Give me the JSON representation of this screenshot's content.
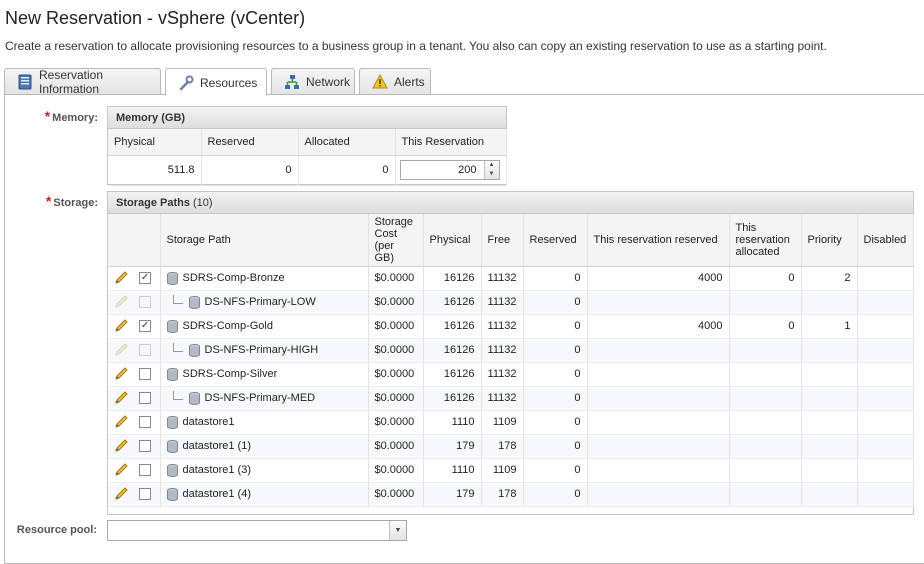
{
  "page": {
    "title": "New Reservation - vSphere (vCenter)",
    "description": "Create a reservation to allocate provisioning resources to a business group in a tenant. You also can copy an existing reservation to use as a starting point."
  },
  "tabs": [
    {
      "label": "Reservation Information",
      "icon": "reservation-info-icon",
      "active": false
    },
    {
      "label": "Resources",
      "icon": "wrench-icon",
      "active": true
    },
    {
      "label": "Network",
      "icon": "network-icon",
      "active": false
    },
    {
      "label": "Alerts",
      "icon": "warning-icon",
      "active": false
    }
  ],
  "memory": {
    "label": "Memory:",
    "panel_title": "Memory (GB)",
    "columns": [
      "Physical",
      "Reserved",
      "Allocated",
      "This Reservation"
    ],
    "values": {
      "physical": "511.8",
      "reserved": "0",
      "allocated": "0",
      "this_reservation": "200"
    }
  },
  "storage": {
    "label": "Storage:",
    "panel_title": "Storage Paths",
    "count": "(10)",
    "columns": [
      "Storage Path",
      "Storage Cost (per GB)",
      "Physical",
      "Free",
      "Reserved",
      "This reservation reserved",
      "This reservation allocated",
      "Priority",
      "Disabled"
    ],
    "rows": [
      {
        "path": "SDRS-Comp-Bronze",
        "child": false,
        "enabled": true,
        "checked": true,
        "cost": "$0.0000",
        "physical": "16126",
        "free": "11132",
        "reserved": "0",
        "this_reserved": "4000",
        "this_allocated": "0",
        "priority": "2",
        "disabled": ""
      },
      {
        "path": "DS-NFS-Primary-LOW",
        "child": true,
        "enabled": false,
        "checked": false,
        "cost": "$0.0000",
        "physical": "16126",
        "free": "11132",
        "reserved": "0",
        "this_reserved": "",
        "this_allocated": "",
        "priority": "",
        "disabled": ""
      },
      {
        "path": "SDRS-Comp-Gold",
        "child": false,
        "enabled": true,
        "checked": true,
        "cost": "$0.0000",
        "physical": "16126",
        "free": "11132",
        "reserved": "0",
        "this_reserved": "4000",
        "this_allocated": "0",
        "priority": "1",
        "disabled": ""
      },
      {
        "path": "DS-NFS-Primary-HIGH",
        "child": true,
        "enabled": false,
        "checked": false,
        "cost": "$0.0000",
        "physical": "16126",
        "free": "11132",
        "reserved": "0",
        "this_reserved": "",
        "this_allocated": "",
        "priority": "",
        "disabled": ""
      },
      {
        "path": "SDRS-Comp-Silver",
        "child": false,
        "enabled": true,
        "checked": false,
        "cost": "$0.0000",
        "physical": "16126",
        "free": "11132",
        "reserved": "0",
        "this_reserved": "",
        "this_allocated": "",
        "priority": "",
        "disabled": ""
      },
      {
        "path": "DS-NFS-Primary-MED",
        "child": true,
        "enabled": true,
        "checked": false,
        "cost": "$0.0000",
        "physical": "16126",
        "free": "11132",
        "reserved": "0",
        "this_reserved": "",
        "this_allocated": "",
        "priority": "",
        "disabled": ""
      },
      {
        "path": "datastore1",
        "child": false,
        "enabled": true,
        "checked": false,
        "cost": "$0.0000",
        "physical": "1110",
        "free": "1109",
        "reserved": "0",
        "this_reserved": "",
        "this_allocated": "",
        "priority": "",
        "disabled": ""
      },
      {
        "path": "datastore1 (1)",
        "child": false,
        "enabled": true,
        "checked": false,
        "cost": "$0.0000",
        "physical": "179",
        "free": "178",
        "reserved": "0",
        "this_reserved": "",
        "this_allocated": "",
        "priority": "",
        "disabled": ""
      },
      {
        "path": "datastore1 (3)",
        "child": false,
        "enabled": true,
        "checked": false,
        "cost": "$0.0000",
        "physical": "1110",
        "free": "1109",
        "reserved": "0",
        "this_reserved": "",
        "this_allocated": "",
        "priority": "",
        "disabled": ""
      },
      {
        "path": "datastore1 (4)",
        "child": false,
        "enabled": true,
        "checked": false,
        "cost": "$0.0000",
        "physical": "179",
        "free": "178",
        "reserved": "0",
        "this_reserved": "",
        "this_allocated": "",
        "priority": "",
        "disabled": ""
      }
    ]
  },
  "resource_pool": {
    "label": "Resource pool:",
    "value": ""
  },
  "colors": {
    "required_star": "#cc2020",
    "header_bg": "#dedede",
    "alt_row": "#f6f8fb"
  }
}
